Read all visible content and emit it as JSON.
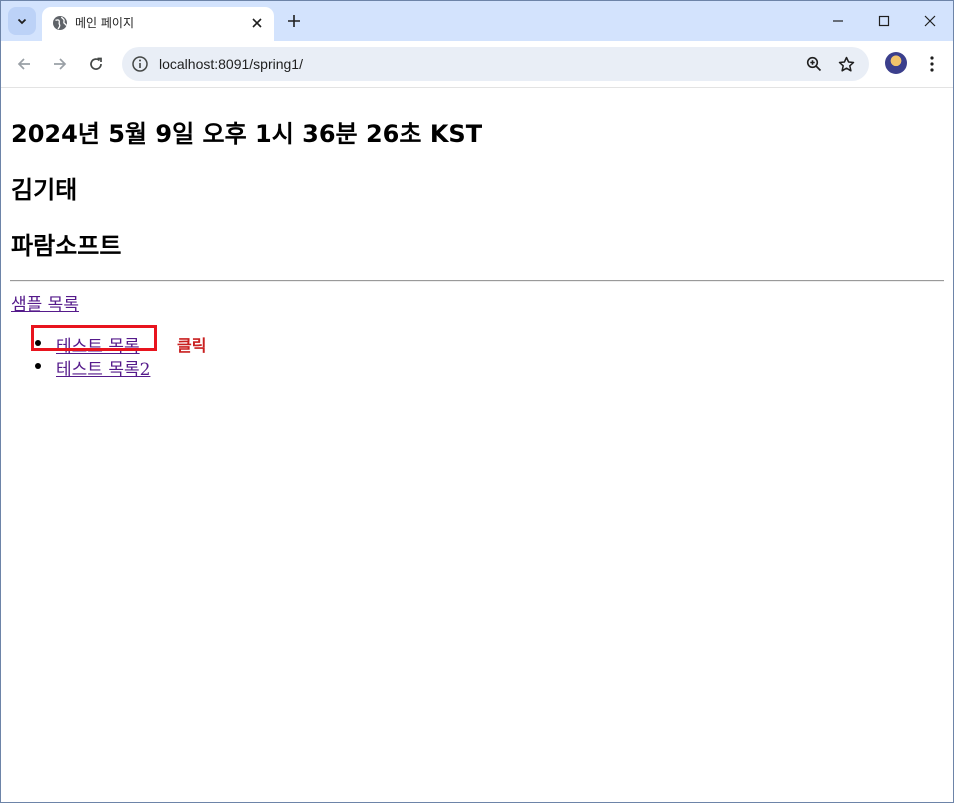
{
  "browser": {
    "tab_title": "메인 페이지",
    "url": "localhost:8091/spring1/",
    "tab_colors": {
      "strip": "#d3e3fd",
      "active": "#ffffff"
    }
  },
  "page": {
    "date_heading": "2024년 5월 9일 오후 1시 36분 26초 KST",
    "name_heading": "김기태",
    "company_heading": "파람소프트",
    "sample_link": "샘플 목록",
    "list_items": [
      {
        "label": "테스트 목록"
      },
      {
        "label": "테스트 목록2"
      }
    ],
    "annotation_label": "클릭",
    "annotation_color": "#e8141e",
    "link_color": "#551a8b"
  }
}
